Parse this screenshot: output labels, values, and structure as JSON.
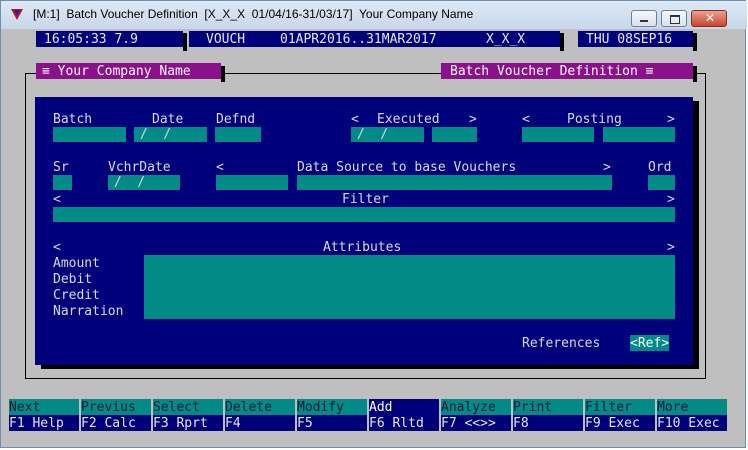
{
  "window": {
    "title": "[M:1]  Batch Voucher Definition  [X_X_X  01/04/16-31/03/17]  Your Company Name"
  },
  "status": {
    "time": "16:05:33 7.9",
    "vouch_label": "VOUCH",
    "period": "01APR2016..31MAR2017",
    "company_code": "X_X_X",
    "date": "THU 08SEP16"
  },
  "menus": {
    "company": "≡ Your Company Name",
    "screen": "Batch Voucher Definition ≡"
  },
  "form": {
    "batch": "Batch",
    "date": "Date",
    "defnd": "Defnd",
    "executed_left": "<",
    "executed": "Executed",
    "executed_right": ">",
    "posting_left": "<",
    "posting": "Posting",
    "posting_right": ">",
    "date_placeholder": " /  /",
    "sr": "Sr",
    "vchr_date": "VchrDate",
    "data_source_left": "<",
    "data_source": "Data Source to base Vouchers",
    "data_source_right": ">",
    "ord": "Ord",
    "filter_left": "<",
    "filter": "Filter",
    "filter_right": ">",
    "attributes_left": "<",
    "attributes": "Attributes",
    "attributes_right": ">",
    "amount": "Amount",
    "debit": "Debit",
    "credit": "Credit",
    "narration": "Narration",
    "references": "References",
    "ref_button": "<Ref>"
  },
  "fkeys": [
    {
      "top": "Next",
      "bottom": "F1 Help"
    },
    {
      "top": "Previus",
      "bottom": "F2 Calc"
    },
    {
      "top": "Select",
      "bottom": "F3 Rprt"
    },
    {
      "top": "Delete",
      "bottom": "F4"
    },
    {
      "top": "Modify",
      "bottom": "F5"
    },
    {
      "top": "Add",
      "bottom": "F6 Rltd"
    },
    {
      "top": "Analyze",
      "bottom": "F7 <<>>"
    },
    {
      "top": "Print",
      "bottom": "F8"
    },
    {
      "top": "Filter",
      "bottom": "F9 Exec"
    },
    {
      "top": "More",
      "bottom": "F10 Exec"
    }
  ]
}
